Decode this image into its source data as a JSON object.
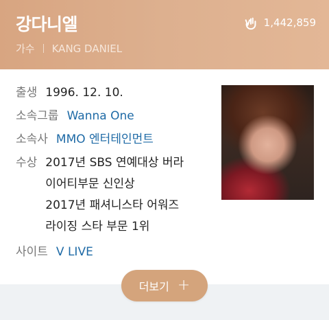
{
  "profile": {
    "name": "강다니엘",
    "category": "가수",
    "english_name": "KANG DANIEL",
    "fan_count": "1,442,859"
  },
  "info": {
    "birth": {
      "label": "출생",
      "value": "1996. 12. 10."
    },
    "group": {
      "label": "소속그룹",
      "value": "Wanna One"
    },
    "agency": {
      "label": "소속사",
      "value": "MMO 엔터테인먼트"
    },
    "awards": {
      "label": "수상",
      "lines": [
        "2017년 SBS 연예대상 버라",
        "이어티부문 신인상",
        "2017년 패셔니스타 어워즈",
        "라이징 스타 부문 1위"
      ]
    },
    "site": {
      "label": "사이트",
      "value": "V LIVE"
    }
  },
  "more_button": {
    "label": "더보기",
    "icon": "plus-icon"
  },
  "colors": {
    "header_bg": "#ddb08f",
    "link": "#1e6aa6",
    "button_bg": "#d4a47c",
    "footer_bg": "#eff2f4"
  }
}
